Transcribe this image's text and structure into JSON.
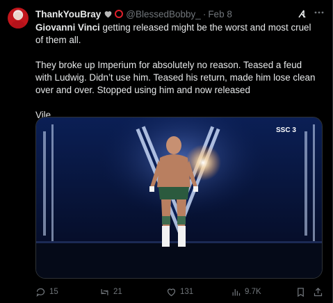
{
  "tweet": {
    "display_name": "ThankYouBray",
    "handle": "@BlessedBobby_",
    "separator": "·",
    "date": "Feb 8",
    "text": {
      "mention": "Giovanni Vinci",
      "line1_rest": " getting released might be the worst and most cruel of them all.",
      "paragraph2": "They broke up Imperium for absolutely no reason. Teased a feud with Ludwig. Didn’t use him. Teased his return, made him lose clean over and over. Stopped using him and now released",
      "paragraph3": "Vile"
    },
    "media": {
      "network_logo": "SSC 3",
      "description_icon": "wrestler-entrance-image"
    },
    "metrics": {
      "replies": "15",
      "reposts": "21",
      "likes": "131",
      "views": "9.7K"
    }
  },
  "icons": {
    "heart": "black-heart-icon",
    "ring": "red-circle-icon",
    "grok": "grok-icon",
    "more": "more-icon",
    "reply": "reply-icon",
    "repost": "repost-icon",
    "like": "like-icon",
    "views": "views-icon",
    "bookmark": "bookmark-icon",
    "share": "share-icon"
  },
  "colors": {
    "background": "#000000",
    "text": "#e7e9ea",
    "muted": "#71767b",
    "ring": "#e0202b"
  }
}
